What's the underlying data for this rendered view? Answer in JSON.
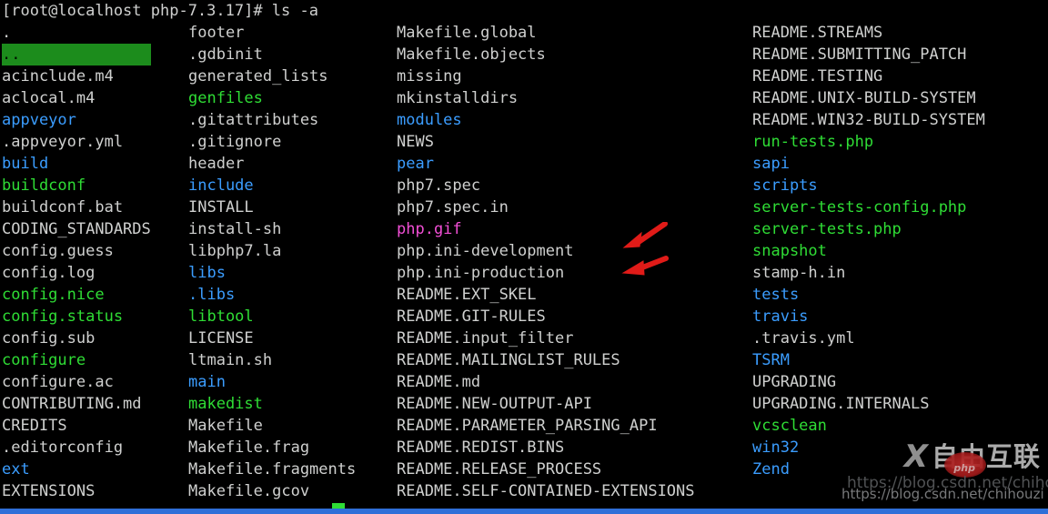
{
  "terminal": {
    "prompt": "[root@localhost php-7.3.17]# ls -a",
    "user": "root",
    "host": "localhost",
    "cwd": "php-7.3.17",
    "command": "ls -a"
  },
  "colors": {
    "background": "#000000",
    "file": "#cfd0cf",
    "directory": "#3b9dff",
    "executable": "#2fdd35",
    "image": "#f24fd6",
    "selected_bg": "#1c8c1c",
    "cursor": "#2fdd35",
    "scrollbar": "#2f6fd8",
    "arrow": "#e01b18"
  },
  "listing": {
    "columns": [
      {
        "entries": [
          {
            "name": ".",
            "type": "file"
          },
          {
            "name": "..",
            "type": "selected"
          },
          {
            "name": "acinclude.m4",
            "type": "file"
          },
          {
            "name": "aclocal.m4",
            "type": "file"
          },
          {
            "name": "appveyor",
            "type": "directory"
          },
          {
            "name": ".appveyor.yml",
            "type": "file"
          },
          {
            "name": "build",
            "type": "directory"
          },
          {
            "name": "buildconf",
            "type": "executable"
          },
          {
            "name": "buildconf.bat",
            "type": "file"
          },
          {
            "name": "CODING_STANDARDS",
            "type": "file"
          },
          {
            "name": "config.guess",
            "type": "file"
          },
          {
            "name": "config.log",
            "type": "file"
          },
          {
            "name": "config.nice",
            "type": "executable"
          },
          {
            "name": "config.status",
            "type": "executable"
          },
          {
            "name": "config.sub",
            "type": "file"
          },
          {
            "name": "configure",
            "type": "executable"
          },
          {
            "name": "configure.ac",
            "type": "file"
          },
          {
            "name": "CONTRIBUTING.md",
            "type": "file"
          },
          {
            "name": "CREDITS",
            "type": "file"
          },
          {
            "name": ".editorconfig",
            "type": "file"
          },
          {
            "name": "ext",
            "type": "directory"
          },
          {
            "name": "EXTENSIONS",
            "type": "file"
          }
        ]
      },
      {
        "entries": [
          {
            "name": "footer",
            "type": "file"
          },
          {
            "name": ".gdbinit",
            "type": "file"
          },
          {
            "name": "generated_lists",
            "type": "file"
          },
          {
            "name": "genfiles",
            "type": "executable"
          },
          {
            "name": ".gitattributes",
            "type": "file"
          },
          {
            "name": ".gitignore",
            "type": "file"
          },
          {
            "name": "header",
            "type": "file"
          },
          {
            "name": "include",
            "type": "directory"
          },
          {
            "name": "INSTALL",
            "type": "file"
          },
          {
            "name": "install-sh",
            "type": "file"
          },
          {
            "name": "libphp7.la",
            "type": "file"
          },
          {
            "name": "libs",
            "type": "directory"
          },
          {
            "name": ".libs",
            "type": "directory"
          },
          {
            "name": "libtool",
            "type": "executable"
          },
          {
            "name": "LICENSE",
            "type": "file"
          },
          {
            "name": "ltmain.sh",
            "type": "file"
          },
          {
            "name": "main",
            "type": "directory"
          },
          {
            "name": "makedist",
            "type": "executable"
          },
          {
            "name": "Makefile",
            "type": "file"
          },
          {
            "name": "Makefile.frag",
            "type": "file"
          },
          {
            "name": "Makefile.fragments",
            "type": "file"
          },
          {
            "name": "Makefile.gcov",
            "type": "file"
          }
        ]
      },
      {
        "entries": [
          {
            "name": "Makefile.global",
            "type": "file"
          },
          {
            "name": "Makefile.objects",
            "type": "file"
          },
          {
            "name": "missing",
            "type": "file"
          },
          {
            "name": "mkinstalldirs",
            "type": "file"
          },
          {
            "name": "modules",
            "type": "directory"
          },
          {
            "name": "NEWS",
            "type": "file"
          },
          {
            "name": "pear",
            "type": "directory"
          },
          {
            "name": "php7.spec",
            "type": "file"
          },
          {
            "name": "php7.spec.in",
            "type": "file"
          },
          {
            "name": "php.gif",
            "type": "image"
          },
          {
            "name": "php.ini-development",
            "type": "file"
          },
          {
            "name": "php.ini-production",
            "type": "file"
          },
          {
            "name": "README.EXT_SKEL",
            "type": "file"
          },
          {
            "name": "README.GIT-RULES",
            "type": "file"
          },
          {
            "name": "README.input_filter",
            "type": "file"
          },
          {
            "name": "README.MAILINGLIST_RULES",
            "type": "file"
          },
          {
            "name": "README.md",
            "type": "file"
          },
          {
            "name": "README.NEW-OUTPUT-API",
            "type": "file"
          },
          {
            "name": "README.PARAMETER_PARSING_API",
            "type": "file"
          },
          {
            "name": "README.REDIST.BINS",
            "type": "file"
          },
          {
            "name": "README.RELEASE_PROCESS",
            "type": "file"
          },
          {
            "name": "README.SELF-CONTAINED-EXTENSIONS",
            "type": "file"
          }
        ]
      },
      {
        "entries": [
          {
            "name": "README.STREAMS",
            "type": "file"
          },
          {
            "name": "README.SUBMITTING_PATCH",
            "type": "file"
          },
          {
            "name": "README.TESTING",
            "type": "file"
          },
          {
            "name": "README.UNIX-BUILD-SYSTEM",
            "type": "file"
          },
          {
            "name": "README.WIN32-BUILD-SYSTEM",
            "type": "file"
          },
          {
            "name": "run-tests.php",
            "type": "executable"
          },
          {
            "name": "sapi",
            "type": "directory"
          },
          {
            "name": "scripts",
            "type": "directory"
          },
          {
            "name": "server-tests-config.php",
            "type": "executable"
          },
          {
            "name": "server-tests.php",
            "type": "executable"
          },
          {
            "name": "snapshot",
            "type": "executable"
          },
          {
            "name": "stamp-h.in",
            "type": "file"
          },
          {
            "name": "tests",
            "type": "directory"
          },
          {
            "name": "travis",
            "type": "directory"
          },
          {
            "name": ".travis.yml",
            "type": "file"
          },
          {
            "name": "TSRM",
            "type": "directory"
          },
          {
            "name": "UPGRADING",
            "type": "file"
          },
          {
            "name": "UPGRADING.INTERNALS",
            "type": "file"
          },
          {
            "name": "vcsclean",
            "type": "executable"
          },
          {
            "name": "win32",
            "type": "directory"
          },
          {
            "name": "Zend",
            "type": "directory"
          }
        ]
      }
    ]
  },
  "annotations": {
    "arrows": [
      {
        "label": "arrow-php-ini-development",
        "target": "php.ini-development"
      },
      {
        "label": "arrow-php-ini-production",
        "target": "php.ini-production"
      }
    ]
  },
  "watermark": {
    "logo_mark": "X",
    "logo_text": "自由互联",
    "badge_text": "php",
    "url": "https://blog.csdn.net/chihouzi"
  }
}
